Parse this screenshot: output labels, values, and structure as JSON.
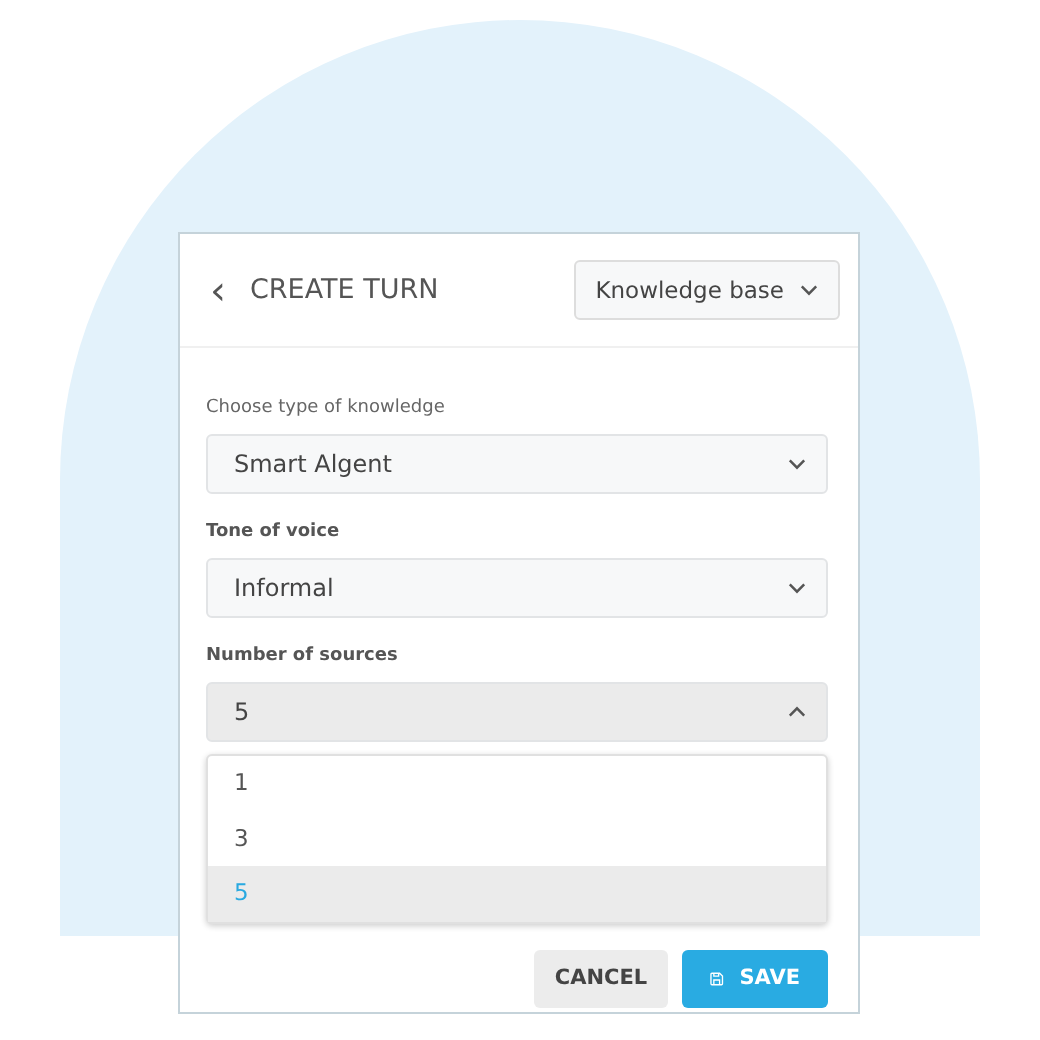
{
  "header": {
    "back_icon": "‹",
    "title": "CREATE TURN",
    "mode_dropdown": {
      "value": "Knowledge base"
    }
  },
  "fields": [
    {
      "label": "Choose type of knowledge",
      "label_bold": false,
      "value": "Smart Algent",
      "expanded": false
    },
    {
      "label": "Tone of voice",
      "label_bold": true,
      "value": "Informal",
      "expanded": false
    },
    {
      "label": "Number of sources",
      "label_bold": true,
      "value": "5",
      "expanded": true
    }
  ],
  "options": [
    {
      "label": "1",
      "selected": false
    },
    {
      "label": "3",
      "selected": false
    },
    {
      "label": "5",
      "selected": true
    }
  ],
  "buttons": [
    {
      "label": "CANCEL",
      "kind": "secondary"
    },
    {
      "label": "SAVE",
      "kind": "primary"
    }
  ]
}
